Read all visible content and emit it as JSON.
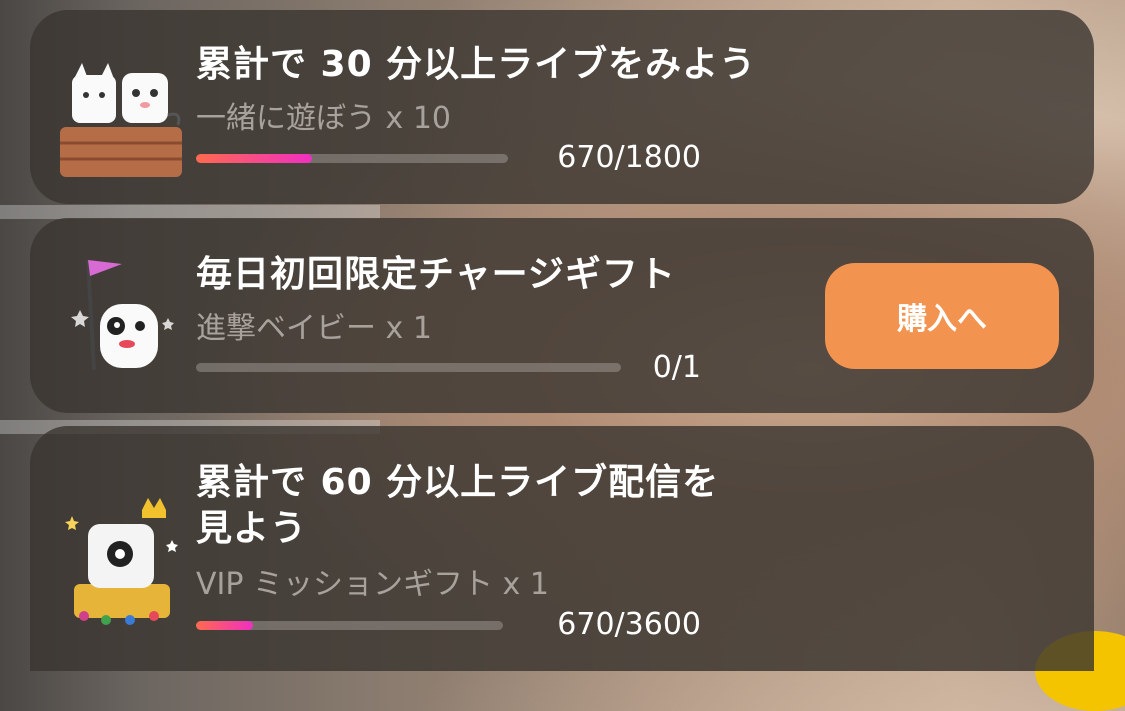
{
  "missions": [
    {
      "title": "累計で 30 分以上ライブをみよう",
      "reward": "一緒に遊ぼう x 10",
      "progress_text": "670/1800",
      "progress_fraction": 0.372,
      "icon": "two-cats-on-crate-icon"
    },
    {
      "title": "毎日初回限定チャージギフト",
      "reward": "進撃ベイビー x 1",
      "progress_text": "0/1",
      "progress_fraction": 0,
      "icon": "mascot-with-flag-icon",
      "button_label": "購入へ"
    },
    {
      "title_line1": "累計で 60 分以上ライブ配信を",
      "title_line2": "見よう",
      "reward": "VIP ミッションギフト x 1",
      "progress_text": "670/3600",
      "progress_fraction": 0.186,
      "icon": "crowned-mascot-on-throne-icon"
    }
  ],
  "colors": {
    "card_bg": "#3a3430",
    "button_bg": "#f29350",
    "progress_start": "#ff6a4e",
    "progress_end": "#f02fc2",
    "subtitle_text": "#a8a29c"
  }
}
